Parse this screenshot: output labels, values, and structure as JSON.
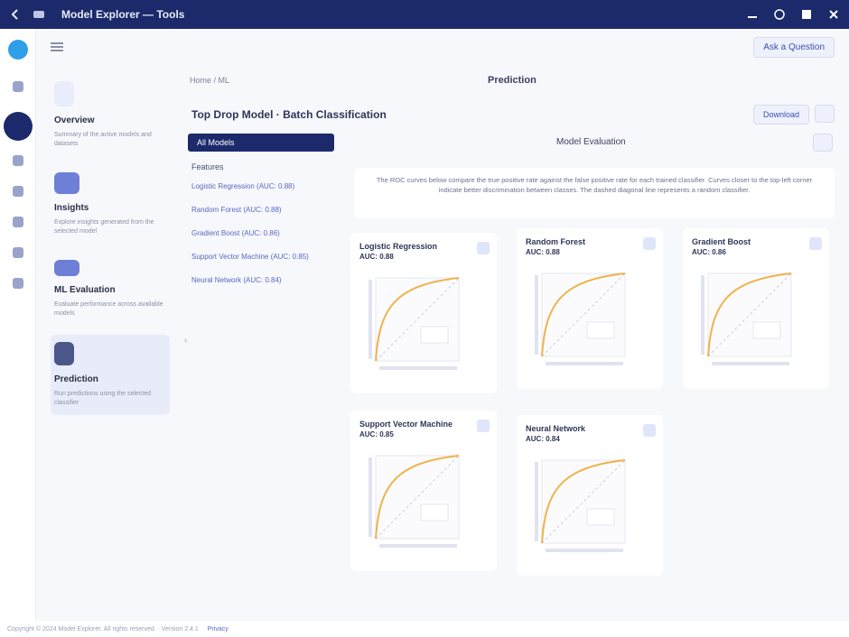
{
  "app": {
    "title": "Model Explorer — Tools"
  },
  "subheader": {
    "action_label": "Ask a Question"
  },
  "apps": [
    {
      "name": "Overview",
      "desc": "Summary of the active models and datasets"
    },
    {
      "name": "Insights",
      "desc": "Explore insights generated from the selected model"
    },
    {
      "name": "ML Evaluation",
      "desc": "Evaluate performance across available models"
    },
    {
      "name": "Prediction",
      "desc": "Run predictions using the selected classifier"
    }
  ],
  "breadcrumb": "Home  /  ML",
  "page_heading": "Prediction",
  "page_title": "Top Drop Model · Batch Classification",
  "top_buttons": {
    "download": "Download"
  },
  "models": {
    "selected": "All Models",
    "section_label": "Features",
    "links": [
      "Logistic Regression (AUC: 0.88)",
      "Random Forest (AUC: 0.88)",
      "Gradient Boost (AUC: 0.86)",
      "Support Vector Machine (AUC: 0.85)",
      "Neural Network (AUC: 0.84)"
    ]
  },
  "detail": {
    "title": "Model Evaluation",
    "description": "The ROC curves below compare the true positive rate against the false positive rate for each trained classifier. Curves closer to the top-left corner indicate better discrimination between classes. The dashed diagonal line represents a random classifier."
  },
  "cards": [
    {
      "title": "Logistic Regression",
      "sub": "AUC: 0.88"
    },
    {
      "title": "Random Forest",
      "sub": "AUC: 0.88"
    },
    {
      "title": "Gradient Boost",
      "sub": "AUC: 0.86"
    },
    {
      "title": "Support Vector Machine",
      "sub": "AUC: 0.85"
    },
    {
      "title": "Neural Network",
      "sub": "AUC: 0.84"
    }
  ],
  "footer": {
    "text": "Copyright © 2024 Model Explorer. All rights reserved.   ·   Version 2.4.1",
    "link": "Privacy"
  },
  "colors": {
    "topbar": "#1c2a6b",
    "accent": "#3b4fb0",
    "curve": "#f0b24a"
  }
}
